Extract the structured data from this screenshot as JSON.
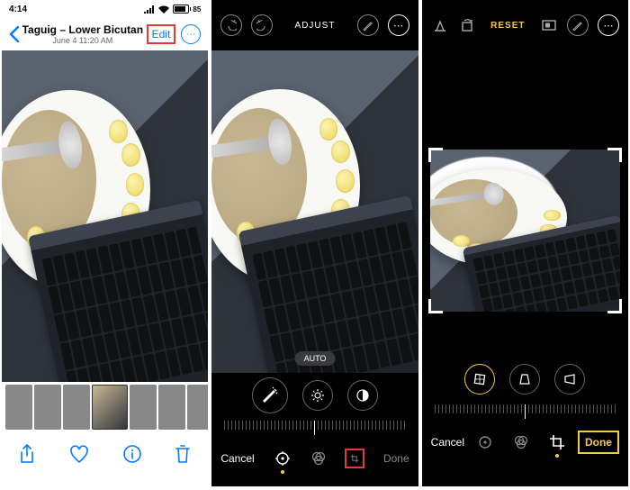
{
  "status": {
    "time": "4:14",
    "battery": "85"
  },
  "screen1": {
    "location": "Taguig – Lower Bicutan",
    "date": "June 4  11:20 AM",
    "edit_label": "Edit"
  },
  "screen2": {
    "mode_label": "ADJUST",
    "auto_label": "AUTO",
    "cancel": "Cancel",
    "done": "Done"
  },
  "screen3": {
    "reset_label": "RESET",
    "cancel": "Cancel",
    "done": "Done"
  }
}
